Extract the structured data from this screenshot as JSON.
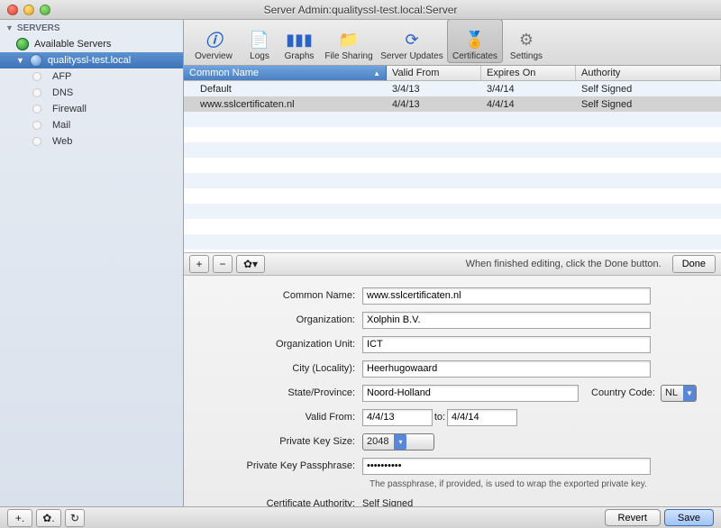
{
  "window": {
    "title": "Server Admin:qualityssl-test.local:Server"
  },
  "sidebar": {
    "header": "SERVERS",
    "available_label": "Available Servers",
    "selected_server": "qualityssl-test.local",
    "services": [
      {
        "label": "AFP"
      },
      {
        "label": "DNS"
      },
      {
        "label": "Firewall"
      },
      {
        "label": "Mail"
      },
      {
        "label": "Web"
      }
    ]
  },
  "toolbar": {
    "items": [
      {
        "label": "Overview"
      },
      {
        "label": "Logs"
      },
      {
        "label": "Graphs"
      },
      {
        "label": "File Sharing"
      },
      {
        "label": "Server Updates"
      },
      {
        "label": "Certificates",
        "selected": true
      },
      {
        "label": "Settings"
      }
    ]
  },
  "table": {
    "columns": {
      "common_name": "Common Name",
      "valid_from": "Valid From",
      "expires_on": "Expires On",
      "authority": "Authority"
    },
    "rows": [
      {
        "common_name": "Default",
        "valid_from": "3/4/13",
        "expires_on": "3/4/14",
        "authority": "Self Signed",
        "selected": false
      },
      {
        "common_name": "www.sslcertificaten.nl",
        "valid_from": "4/4/13",
        "expires_on": "4/4/14",
        "authority": "Self Signed",
        "selected": true
      }
    ]
  },
  "mini_bar": {
    "hint": "When finished editing, click the Done button.",
    "done": "Done"
  },
  "form": {
    "labels": {
      "common_name": "Common Name:",
      "organization": "Organization:",
      "organization_unit": "Organization Unit:",
      "city": "City (Locality):",
      "state": "State/Province:",
      "country_code": "Country Code:",
      "valid_from": "Valid From:",
      "to": "to:",
      "private_key_size": "Private Key Size:",
      "passphrase": "Private Key Passphrase:",
      "cert_authority": "Certificate Authority:"
    },
    "values": {
      "common_name": "www.sslcertificaten.nl",
      "organization": "Xolphin B.V.",
      "organization_unit": "ICT",
      "city": "Heerhugowaard",
      "state": "Noord-Holland",
      "country_code": "NL",
      "valid_from": "4/4/13",
      "valid_to": "4/4/14",
      "private_key_size": "2048",
      "passphrase": "••••••••••",
      "cert_authority": "Self Signed"
    },
    "passphrase_note": "The passphrase, if provided, is used to wrap the exported private key."
  },
  "bottom": {
    "revert": "Revert",
    "save": "Save"
  }
}
